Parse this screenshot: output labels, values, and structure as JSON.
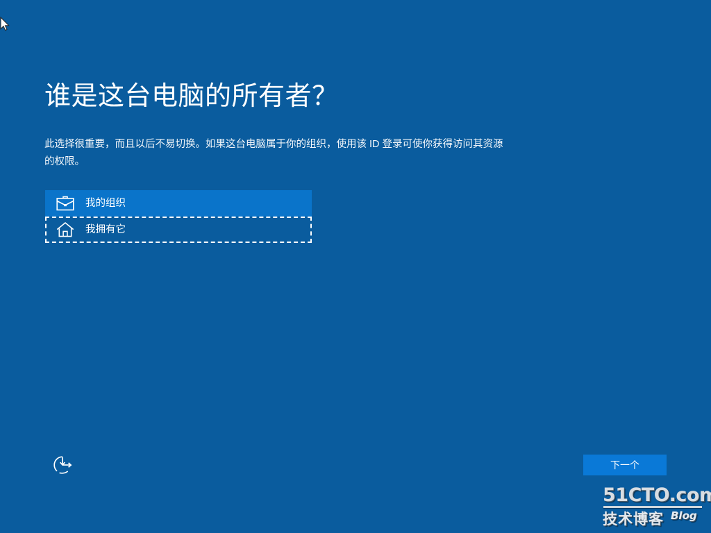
{
  "screen": {
    "background_color": "#0a5c9e",
    "accent_color": "#0a79d7",
    "selected_row_color": "#0a74ca",
    "title": "谁是这台电脑的所有者？",
    "description": "此选择很重要，而且以后不易切换。如果这台电脑属于你的组织，使用该 ID 登录可使你获得访问其资源的权限。"
  },
  "options": [
    {
      "label": "我的组织",
      "icon": "briefcase-icon",
      "state": "selected"
    },
    {
      "label": "我拥有它",
      "icon": "home-icon",
      "state": "focused"
    }
  ],
  "footer": {
    "ease_of_access_icon": "ease-of-access-icon",
    "next_label": "下一个"
  },
  "watermark": {
    "primary": "51CTO.com",
    "secondary": "技术博客",
    "blog": "Blog"
  }
}
